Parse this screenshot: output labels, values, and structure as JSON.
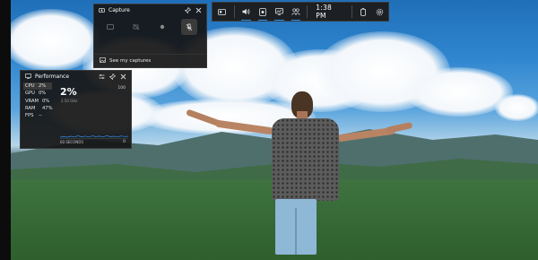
{
  "toolbar": {
    "time": "1:38 PM",
    "buttons": [
      "widget-menu",
      "audio",
      "capture",
      "performance",
      "xbox-social"
    ]
  },
  "capture": {
    "title": "Capture",
    "see_captures": "See my captures"
  },
  "performance": {
    "title": "Performance",
    "metrics": [
      {
        "name": "CPU",
        "value": "2%"
      },
      {
        "name": "GPU",
        "value": "0%"
      },
      {
        "name": "VRAM",
        "value": "0%"
      },
      {
        "name": "RAM",
        "value": "47%"
      },
      {
        "name": "FPS",
        "value": "--"
      }
    ],
    "big_value": "2%",
    "sub_value": "2.50 GHz",
    "max_label": "100",
    "min_label": "0",
    "duration": "60 SECONDS"
  },
  "colors": {
    "accent": "#2f8ee8",
    "panel": "#161616"
  }
}
